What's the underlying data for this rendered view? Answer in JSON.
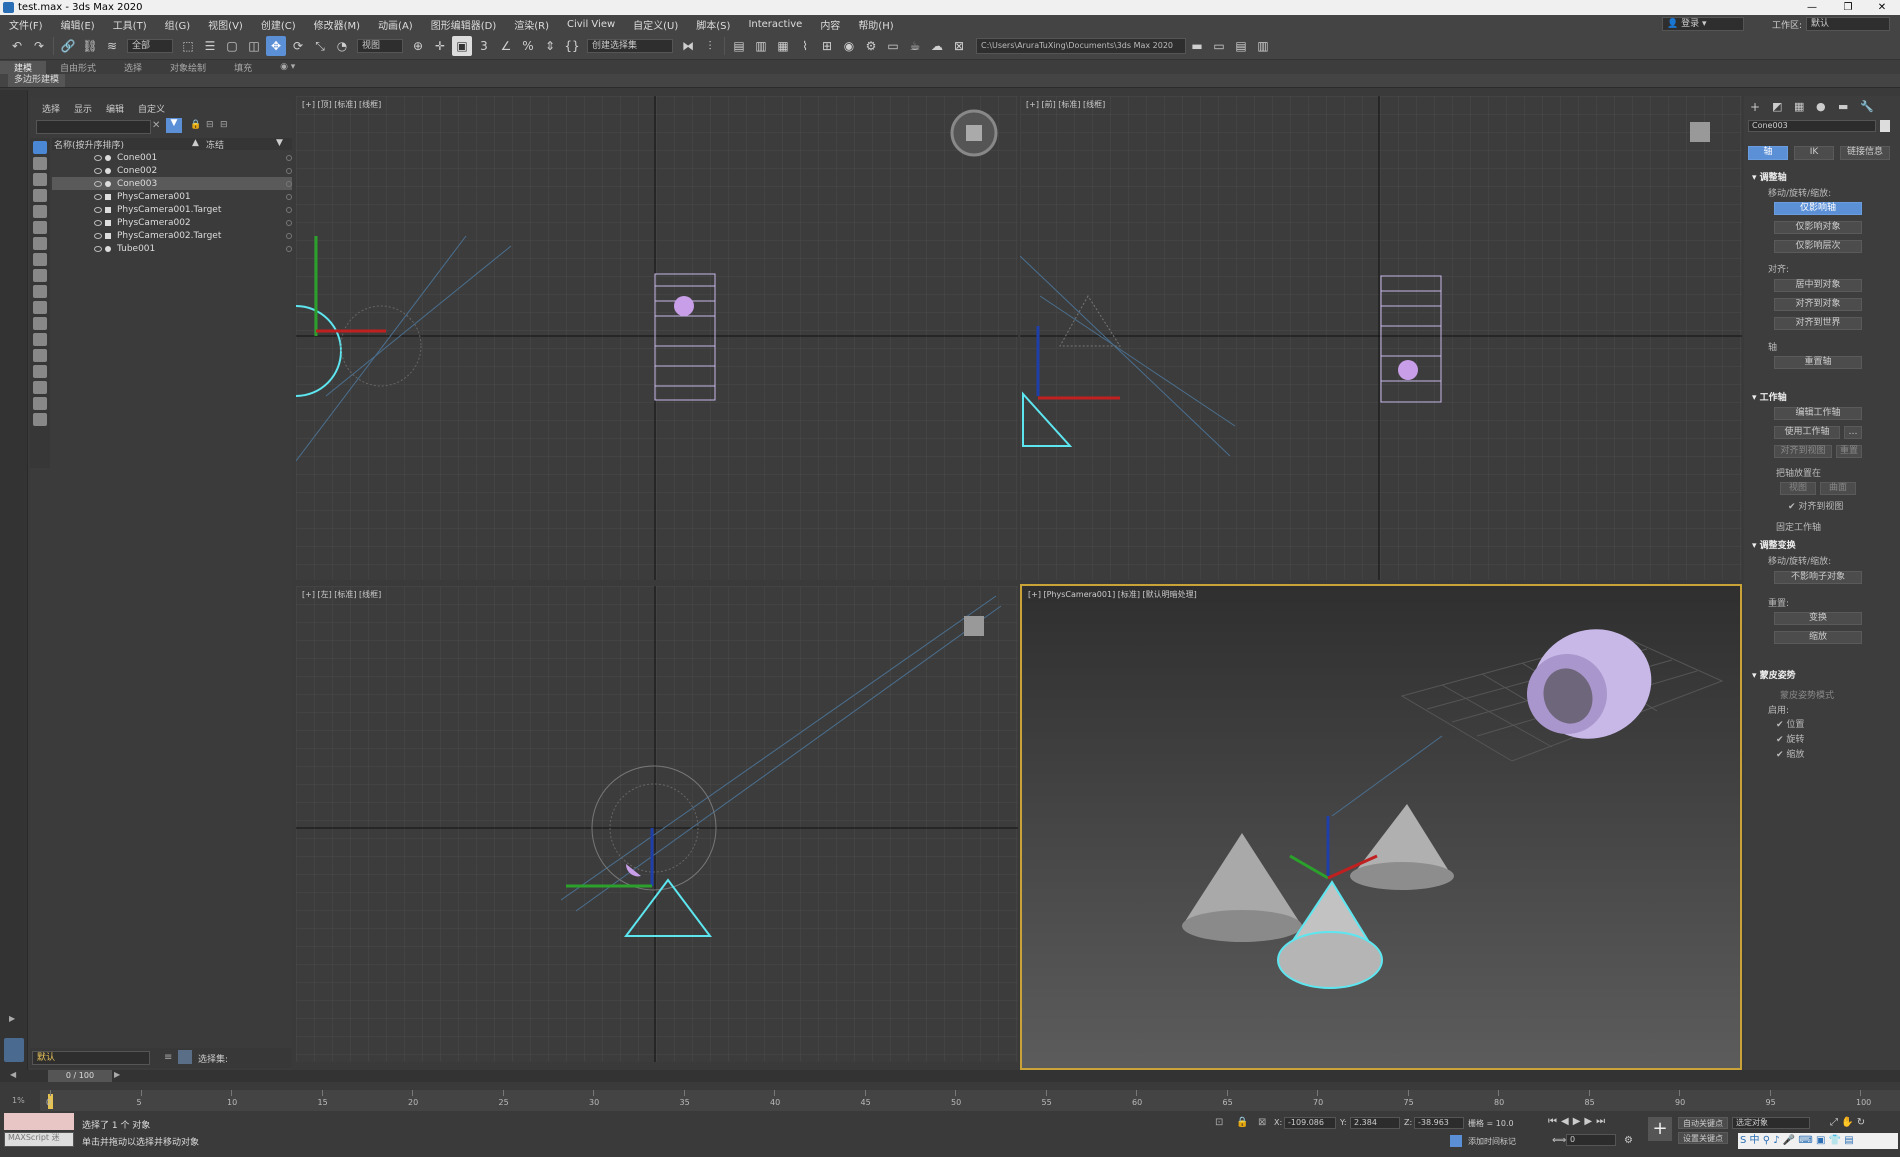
{
  "window": {
    "title": "test.max - 3ds Max 2020",
    "min": "—",
    "max": "❐",
    "close": "✕"
  },
  "menu": [
    "文件(F)",
    "编辑(E)",
    "工具(T)",
    "组(G)",
    "视图(V)",
    "创建(C)",
    "修改器(M)",
    "动画(A)",
    "图形编辑器(D)",
    "渲染(R)",
    "Civil View",
    "自定义(U)",
    "脚本(S)",
    "Interactive",
    "内容",
    "帮助(H)"
  ],
  "menu_right": {
    "login": "登录",
    "workspace_label": "工作区:",
    "workspace": "默认"
  },
  "toolbar": {
    "filter": "全部",
    "refcoord": "视图",
    "selset": "创建选择集",
    "path": "C:\\Users\\AruraTuXing\\Documents\\3ds Max 2020"
  },
  "ribbon": {
    "tabs": [
      "建模",
      "自由形式",
      "选择",
      "对象绘制",
      "填充"
    ],
    "sub": "多边形建模"
  },
  "explorer": {
    "tabs": [
      "选择",
      "显示",
      "编辑",
      "自定义"
    ],
    "col_name": "名称(按升序排序)",
    "col_freeze": "冻结",
    "rows": [
      "Cone001",
      "Cone002",
      "Cone003",
      "PhysCamera001",
      "PhysCamera001.Target",
      "PhysCamera002",
      "PhysCamera002.Target",
      "Tube001"
    ],
    "layer": "默认",
    "selset_label": "选择集:"
  },
  "viewports": {
    "top": "[+] [顶] [标准] [线框]",
    "front": "[+] [前] [标准] [线框]",
    "left": "[+] [左] [标准] [线框]",
    "camera": "[+] [PhysCamera001] [标准] [默认明暗处理]"
  },
  "cmdpanel": {
    "object_name": "Cone003",
    "tabs": [
      "轴",
      "IK",
      "链接信息"
    ],
    "adjust_pivot": "调整轴",
    "move_rot_scale": "移动/旋转/缩放:",
    "affect_pivot": "仅影响轴",
    "affect_object": "仅影响对象",
    "affect_hierarchy": "仅影响层次",
    "align": "对齐:",
    "center_to_object": "居中到对象",
    "align_to_object": "对齐到对象",
    "align_to_world": "对齐到世界",
    "pivot": "轴",
    "reset_pivot": "重置轴",
    "working_pivot": "工作轴",
    "edit_working_pivot": "编辑工作轴",
    "use_working_pivot": "使用工作轴",
    "align_to_view": "对齐到视图",
    "reset": "重置",
    "place_pivot_to": "把轴放置在",
    "view": "视图",
    "surface": "曲面",
    "align_to_view_chk": "✔ 对齐到视图",
    "pin_working_pivot": "固定工作轴",
    "adjust_transform": "调整变换",
    "mrs2": "移动/旋转/缩放:",
    "dont_affect_children": "不影响子对象",
    "reset2": "重置:",
    "transform": "变换",
    "scale": "缩放",
    "skin_pose": "蒙皮姿势",
    "skin_pose_mode": "蒙皮姿势模式",
    "enable": "启用:",
    "position": "✔ 位置",
    "rotation": "✔ 旋转",
    "scale_chk": "✔ 缩放"
  },
  "timeline": {
    "frame": "0 / 100",
    "ticks": [
      "0",
      "5",
      "10",
      "15",
      "20",
      "25",
      "30",
      "35",
      "40",
      "45",
      "50",
      "55",
      "60",
      "65",
      "70",
      "75",
      "80",
      "85",
      "90",
      "95",
      "100"
    ]
  },
  "status": {
    "maxscript": "MAXScript 迷",
    "line1": "选择了 1 个 对象",
    "line2": "单击并拖动以选择并移动对象",
    "x_label": "X:",
    "x": "-109.086",
    "y_label": "Y:",
    "y": "2.384",
    "z_label": "Z:",
    "z": "-38.963",
    "grid": "栅格 = 10.0",
    "add_time_tag": "添加时间标记",
    "auto_key": "自动关键点",
    "set_key": "设置关键点",
    "selected_obj": "选定对象",
    "frame_field": "0"
  },
  "colors": {
    "accent": "#5b8fd6",
    "active_vp": "#c9a338",
    "selected_wire": "#5ee6f0",
    "tube": "#c8b8e8"
  }
}
